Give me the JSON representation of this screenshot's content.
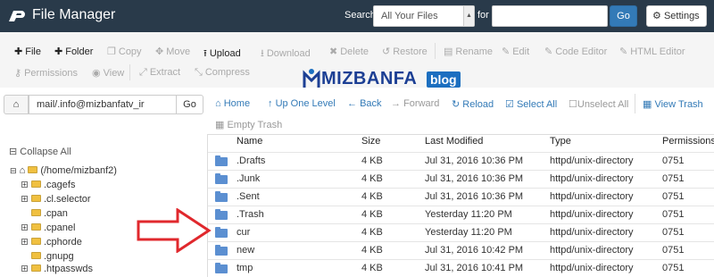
{
  "header": {
    "title": "File Manager",
    "search_label": "Search",
    "search_scope": "All Your Files",
    "for_label": "for",
    "search_value": "",
    "go_label": "Go",
    "settings_label": "Settings"
  },
  "toolbar": {
    "file": "File",
    "folder": "Folder",
    "copy": "Copy",
    "move": "Move",
    "upload": "Upload",
    "download": "Download",
    "delete": "Delete",
    "restore": "Restore",
    "rename": "Rename",
    "edit": "Edit",
    "code_editor": "Code Editor",
    "html_editor": "HTML Editor",
    "permissions": "Permissions",
    "view": "View",
    "extract": "Extract",
    "compress": "Compress"
  },
  "watermark": {
    "text": "MIZBANFA",
    "badge": "blog"
  },
  "pathbar": {
    "value": "mail/.info@mizbanfatv_ir",
    "go_label": "Go"
  },
  "nav": {
    "home": "Home",
    "up_one_level": "Up One Level",
    "back": "Back",
    "forward": "Forward",
    "reload": "Reload",
    "select_all": "Select All",
    "unselect_all": "Unselect All",
    "view_trash": "View Trash",
    "empty_trash": "Empty Trash"
  },
  "tree": {
    "collapse_all": "Collapse All",
    "root": "(/home/mizbanf2)",
    "items": [
      ".cagefs",
      ".cl.selector",
      ".cpan",
      ".cpanel",
      ".cphorde",
      ".gnupg",
      ".htpasswds"
    ]
  },
  "table": {
    "columns": [
      "Name",
      "Size",
      "Last Modified",
      "Type",
      "Permissions"
    ],
    "rows": [
      {
        "name": ".Drafts",
        "size": "4 KB",
        "modified": "Jul 31, 2016 10:36 PM",
        "type": "httpd/unix-directory",
        "perms": "0751"
      },
      {
        "name": ".Junk",
        "size": "4 KB",
        "modified": "Jul 31, 2016 10:36 PM",
        "type": "httpd/unix-directory",
        "perms": "0751"
      },
      {
        "name": ".Sent",
        "size": "4 KB",
        "modified": "Jul 31, 2016 10:36 PM",
        "type": "httpd/unix-directory",
        "perms": "0751"
      },
      {
        "name": ".Trash",
        "size": "4 KB",
        "modified": "Yesterday 11:20 PM",
        "type": "httpd/unix-directory",
        "perms": "0751"
      },
      {
        "name": "cur",
        "size": "4 KB",
        "modified": "Yesterday 11:20 PM",
        "type": "httpd/unix-directory",
        "perms": "0751"
      },
      {
        "name": "new",
        "size": "4 KB",
        "modified": "Jul 31, 2016 10:42 PM",
        "type": "httpd/unix-directory",
        "perms": "0751"
      },
      {
        "name": "tmp",
        "size": "4 KB",
        "modified": "Jul 31, 2016 10:41 PM",
        "type": "httpd/unix-directory",
        "perms": "0751"
      }
    ]
  },
  "colors": {
    "header_bg": "#293a4a",
    "accent": "#337ab7",
    "arrow": "#e0282d",
    "watermark": "#1c3f94"
  }
}
